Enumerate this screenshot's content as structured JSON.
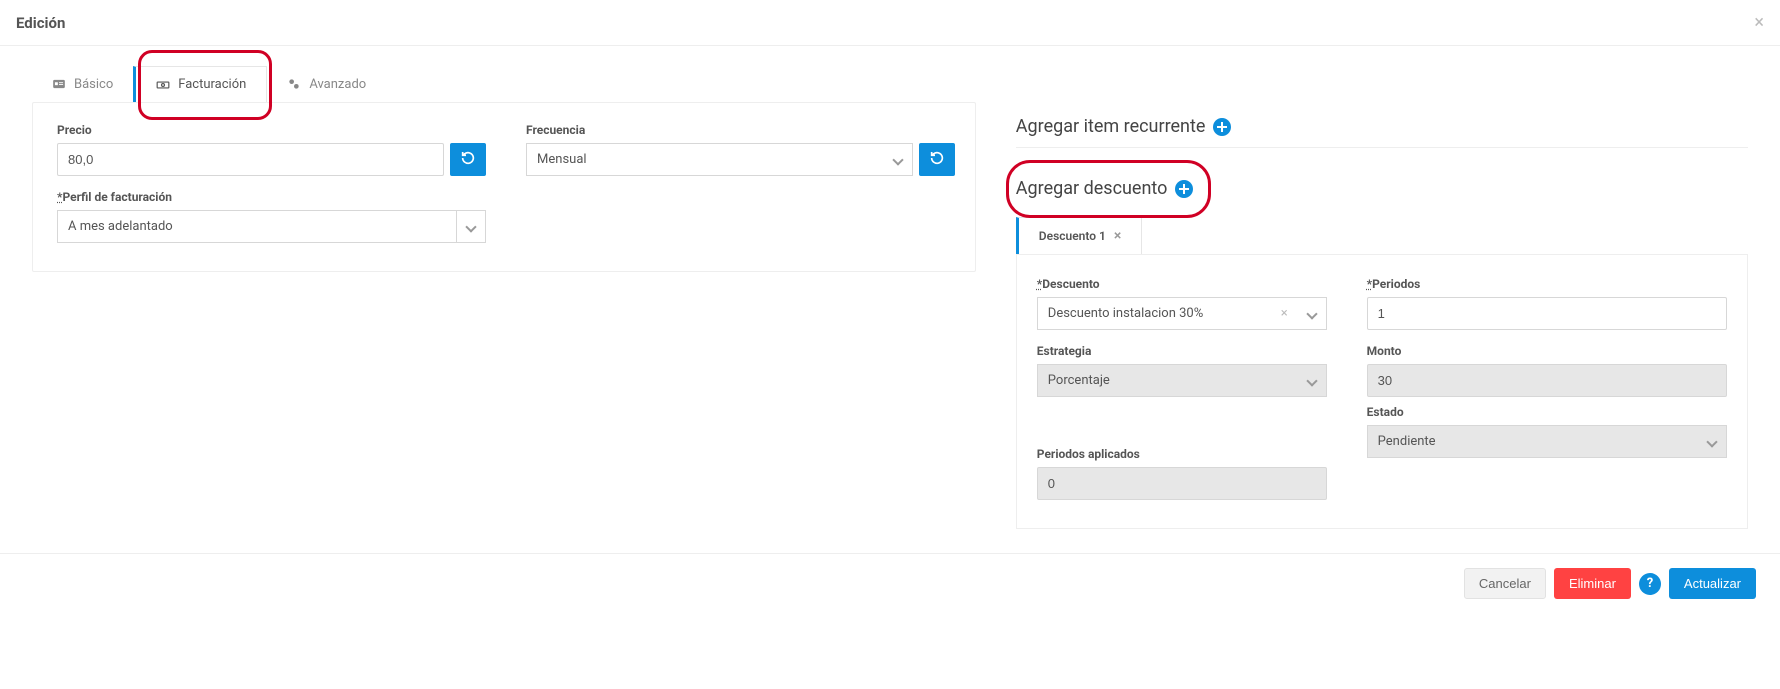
{
  "header": {
    "title": "Edición"
  },
  "tabs": {
    "basic": "Básico",
    "billing": "Facturación",
    "advanced": "Avanzado"
  },
  "left": {
    "price_label": "Precio",
    "price_value": "80,0",
    "profile_label": "Perfil de facturación",
    "profile_value": "A mes adelantado",
    "freq_label": "Frecuencia",
    "freq_value": "Mensual"
  },
  "right": {
    "recurrent_title": "Agregar item recurrente",
    "discount_title": "Agregar descuento",
    "discount_tab": "Descuento 1",
    "discount_label": "Descuento",
    "discount_value": "Descuento instalacion 30%",
    "strategy_label": "Estrategia",
    "strategy_value": "Porcentaje",
    "applied_label": "Periodos aplicados",
    "applied_value": "0",
    "periods_label": "Periodos",
    "periods_value": "1",
    "amount_label": "Monto",
    "amount_value": "30",
    "state_label": "Estado",
    "state_value": "Pendiente"
  },
  "footer": {
    "cancel": "Cancelar",
    "delete": "Eliminar",
    "update": "Actualizar"
  }
}
